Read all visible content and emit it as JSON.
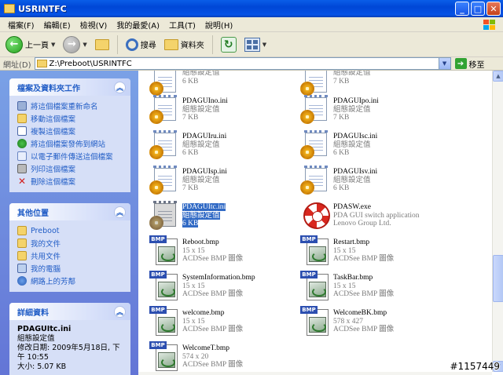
{
  "window": {
    "title": "USRINTFC"
  },
  "menu": [
    "檔案(F)",
    "編輯(E)",
    "檢視(V)",
    "我的最愛(A)",
    "工具(T)",
    "說明(H)"
  ],
  "toolbar": {
    "back_label": "上一頁",
    "search_label": "搜尋",
    "folders_label": "資料夾"
  },
  "address": {
    "label": "網址(D)",
    "value": "Z:\\Preboot\\USRINTFC",
    "go_label": "移至"
  },
  "tasks_panel": {
    "title": "檔案及資料夾工作",
    "items": [
      "將這個檔案重新命名",
      "移動這個檔案",
      "複製這個檔案",
      "將這個檔案發佈到網站",
      "以電子郵件傳送這個檔案",
      "列印這個檔案",
      "刪除這個檔案"
    ]
  },
  "places_panel": {
    "title": "其他位置",
    "items": [
      "Preboot",
      "我的文件",
      "共用文件",
      "我的電腦",
      "網路上的芳鄰"
    ]
  },
  "details_panel": {
    "title": "詳細資料",
    "filename": "PDAGUItc.ini",
    "type": "組態設定值",
    "modified": "修改日期: 2009年5月18日, 下午 10:55",
    "size": "大小: 5.07 KB"
  },
  "files": [
    {
      "name": "",
      "line2": "組態設定值",
      "line3": "6 KB",
      "icon": "ini-settings-icon"
    },
    {
      "name": "",
      "line2": "組態設定值",
      "line3": "7 KB",
      "icon": "ini-settings-icon"
    },
    {
      "name": "PDAGUIno.ini",
      "line2": "組態設定值",
      "line3": "7 KB",
      "icon": "ini-settings-icon"
    },
    {
      "name": "PDAGUIpo.ini",
      "line2": "組態設定值",
      "line3": "7 KB",
      "icon": "ini-settings-icon"
    },
    {
      "name": "PDAGUIru.ini",
      "line2": "組態設定值",
      "line3": "6 KB",
      "icon": "ini-settings-icon"
    },
    {
      "name": "PDAGUIsc.ini",
      "line2": "組態設定值",
      "line3": "6 KB",
      "icon": "ini-settings-icon"
    },
    {
      "name": "PDAGUIsp.ini",
      "line2": "組態設定值",
      "line3": "7 KB",
      "icon": "ini-settings-icon"
    },
    {
      "name": "PDAGUIsv.ini",
      "line2": "組態設定值",
      "line3": "6 KB",
      "icon": "ini-settings-icon"
    },
    {
      "name": "PDAGUItc.ini",
      "line2": "組態設定值",
      "line3": "6 KB",
      "icon": "ini-settings-icon",
      "selected": true
    },
    {
      "name": "PDASW.exe",
      "line2": "PDA GUI switch application",
      "line3": "Lenovo Group Ltd.",
      "icon": "lifebuoy-app-icon"
    },
    {
      "name": "Reboot.bmp",
      "line2": "15 x 15",
      "line3": "ACDSee BMP 圖像",
      "icon": "bmp-image-icon"
    },
    {
      "name": "Restart.bmp",
      "line2": "15 x 15",
      "line3": "ACDSee BMP 圖像",
      "icon": "bmp-image-icon"
    },
    {
      "name": "SystemInformation.bmp",
      "line2": "15 x 15",
      "line3": "ACDSee BMP 圖像",
      "icon": "bmp-image-icon"
    },
    {
      "name": "TaskBar.bmp",
      "line2": "15 x 15",
      "line3": "ACDSee BMP 圖像",
      "icon": "bmp-image-icon"
    },
    {
      "name": "welcome.bmp",
      "line2": "15 x 15",
      "line3": "ACDSee BMP 圖像",
      "icon": "bmp-image-icon"
    },
    {
      "name": "WelcomeBK.bmp",
      "line2": "578 x 427",
      "line3": "ACDSee BMP 圖像",
      "icon": "bmp-image-icon"
    },
    {
      "name": "WelcomeT.bmp",
      "line2": "574 x 20",
      "line3": "ACDSee BMP 圖像",
      "icon": "bmp-image-icon"
    }
  ],
  "watermark": "#1157449"
}
